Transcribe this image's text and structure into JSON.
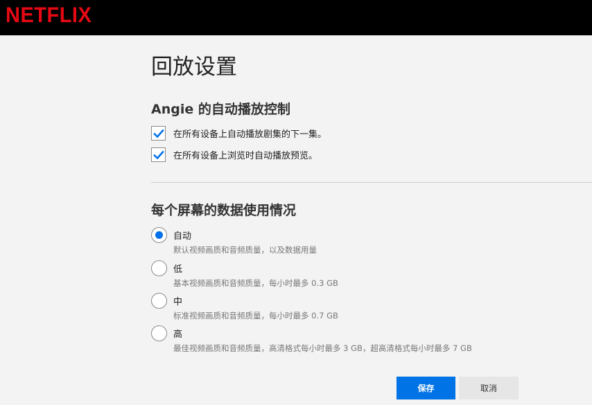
{
  "header": {
    "logo_text": "NETFLIX",
    "logo_color": "#e50914"
  },
  "page": {
    "title": "回放设置"
  },
  "autoplay": {
    "title": "Angie 的自动播放控制",
    "options": [
      {
        "label": "在所有设备上自动播放剧集的下一集。",
        "checked": true
      },
      {
        "label": "在所有设备上浏览时自动播放预览。",
        "checked": true
      }
    ]
  },
  "data_usage": {
    "title": "每个屏幕的数据使用情况",
    "selected": "自动",
    "options": [
      {
        "label": "自动",
        "desc": "默认视频画质和音频质量，以及数据用量"
      },
      {
        "label": "低",
        "desc": "基本视频画质和音频质量，每小时最多 0.3 GB"
      },
      {
        "label": "中",
        "desc": "标准视频画质和音频质量，每小时最多 0.7 GB"
      },
      {
        "label": "高",
        "desc": "最佳视频画质和音频质量，高清格式每小时最多 3 GB，超高清格式每小时最多 7 GB"
      }
    ]
  },
  "buttons": {
    "save_label": "保存",
    "cancel_label": "取消"
  },
  "colors": {
    "accent": "#0071eb",
    "save_button": "#0073e6",
    "background": "#f3f3f3"
  }
}
